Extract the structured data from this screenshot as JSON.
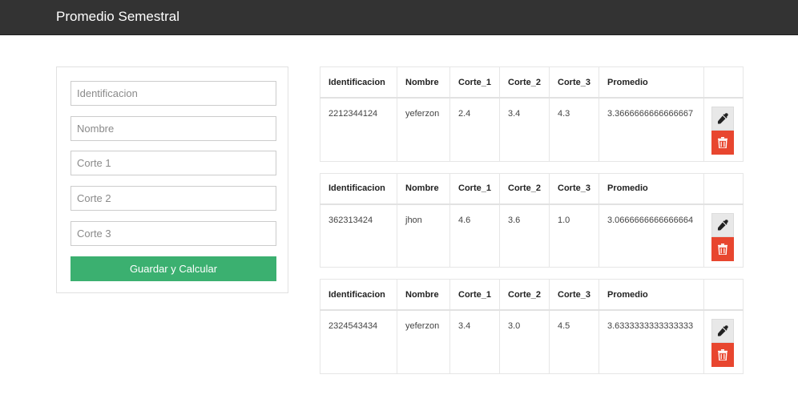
{
  "app": {
    "title": "Promedio Semestral"
  },
  "form": {
    "identificacion_placeholder": "Identificacion",
    "nombre_placeholder": "Nombre",
    "corte1_placeholder": "Corte 1",
    "corte2_placeholder": "Corte 2",
    "corte3_placeholder": "Corte 3",
    "submit_label": "Guardar y Calcular"
  },
  "table_headers": [
    "Identificacion",
    "Nombre",
    "Corte_1",
    "Corte_2",
    "Corte_3",
    "Promedio",
    ""
  ],
  "records": [
    {
      "identificacion": "2212344124",
      "nombre": "yeferzon",
      "corte_1": "2.4",
      "corte_2": "3.4",
      "corte_3": "4.3",
      "promedio": "3.3666666666666667"
    },
    {
      "identificacion": "362313424",
      "nombre": "jhon",
      "corte_1": "4.6",
      "corte_2": "3.6",
      "corte_3": "1.0",
      "promedio": "3.0666666666666664"
    },
    {
      "identificacion": "2324543434",
      "nombre": "yeferzon",
      "corte_1": "3.4",
      "corte_2": "3.0",
      "corte_3": "4.5",
      "promedio": "3.6333333333333333"
    }
  ],
  "icons": {
    "edit": "eyedropper-icon",
    "delete": "trash-icon"
  },
  "colors": {
    "navbar": "#333333",
    "primary_button": "#3bb070",
    "delete_button": "#e8462f"
  }
}
